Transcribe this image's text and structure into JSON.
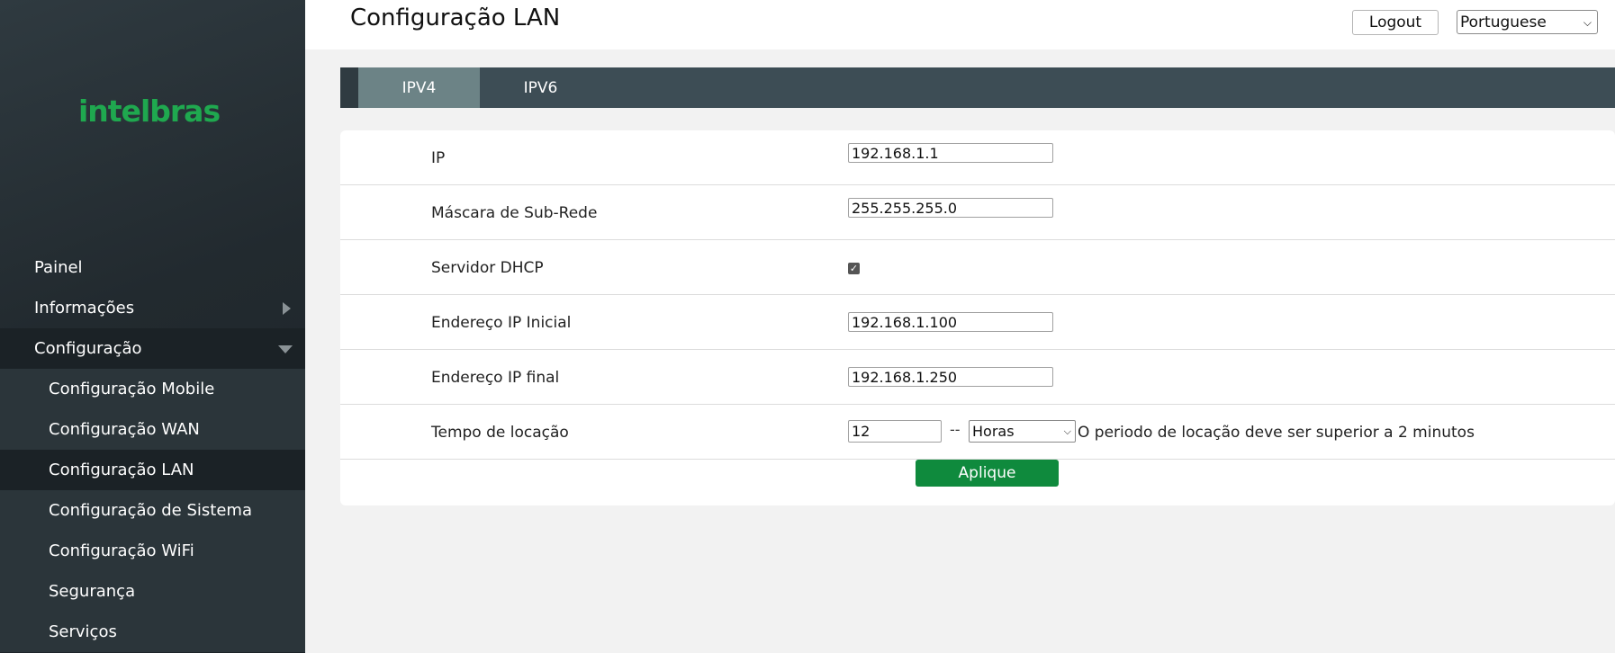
{
  "brand": {
    "logo_text": "intelbras",
    "logo_color": "#1fa84f"
  },
  "sidebar": {
    "items": [
      {
        "label": "Painel"
      },
      {
        "label": "Informações"
      },
      {
        "label": "Configuração"
      },
      {
        "label": "Configuração Mobile"
      },
      {
        "label": "Configuração WAN"
      },
      {
        "label": "Configuração LAN"
      },
      {
        "label": "Configuração de Sistema"
      },
      {
        "label": "Configuração WiFi"
      },
      {
        "label": "Segurança"
      },
      {
        "label": "Serviços"
      }
    ]
  },
  "header": {
    "title": "Configuração LAN",
    "logout_label": "Logout",
    "language": "Portuguese"
  },
  "tabs": [
    {
      "label": "IPV4",
      "active": true
    },
    {
      "label": "IPV6",
      "active": false
    }
  ],
  "form": {
    "ip_label": "IP",
    "ip_value": "192.168.1.1",
    "mask_label": "Máscara de Sub-Rede",
    "mask_value": "255.255.255.0",
    "dhcp_label": "Servidor DHCP",
    "dhcp_checked": true,
    "start_label": "Endereço IP Inicial",
    "start_value": "192.168.1.100",
    "end_label": "Endereço IP final",
    "end_value": "192.168.1.250",
    "lease_label": "Tempo de locação",
    "lease_value": "12",
    "lease_separator": "--",
    "lease_unit": "Horas",
    "lease_note": "O periodo de locação deve ser superior a 2 minutos",
    "apply_label": "Aplique"
  },
  "colors": {
    "accent": "#0f8a3d",
    "tab_bar": "#3d4d55",
    "tab_active": "#6c8386"
  }
}
